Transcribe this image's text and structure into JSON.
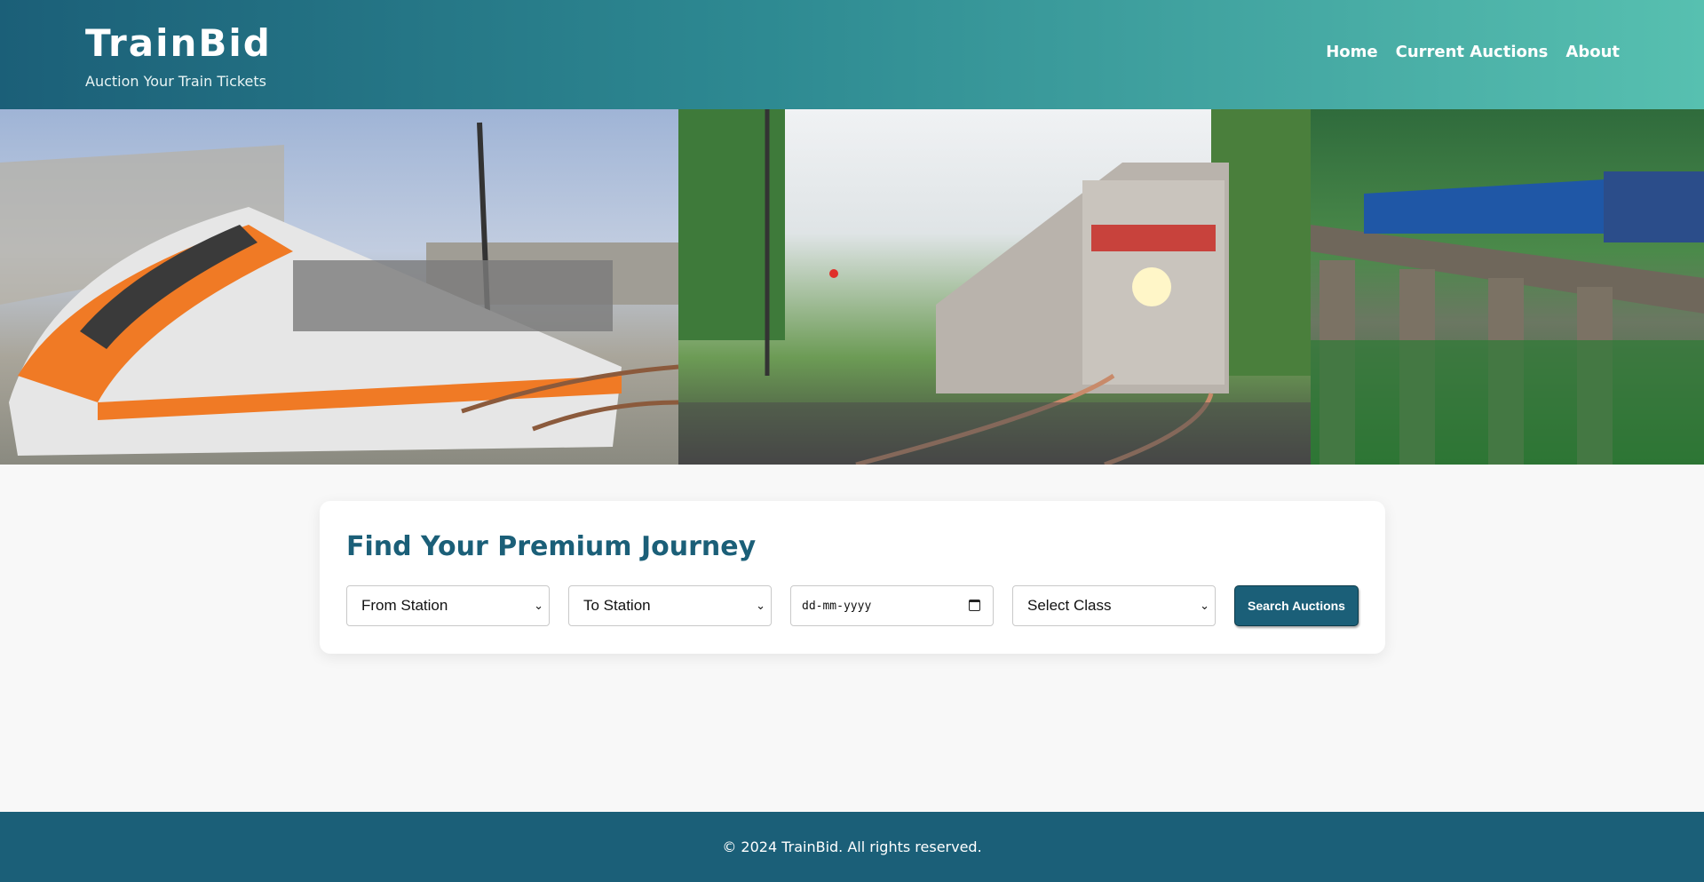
{
  "header": {
    "title": "TrainBid",
    "subtitle": "Auction Your Train Tickets",
    "nav": [
      {
        "label": "Home"
      },
      {
        "label": "Current Auctions"
      },
      {
        "label": "About"
      }
    ]
  },
  "search": {
    "title": "Find Your Premium Journey",
    "from_placeholder": "From Station",
    "to_placeholder": "To Station",
    "date_placeholder": "dd-mm-yyyy",
    "class_placeholder": "Select Class",
    "button_label": "Search Auctions"
  },
  "footer": {
    "text": "© 2024 TrainBid. All rights reserved."
  },
  "colors": {
    "primary": "#1b5f78",
    "header_gradient_end": "#57c0b0"
  }
}
